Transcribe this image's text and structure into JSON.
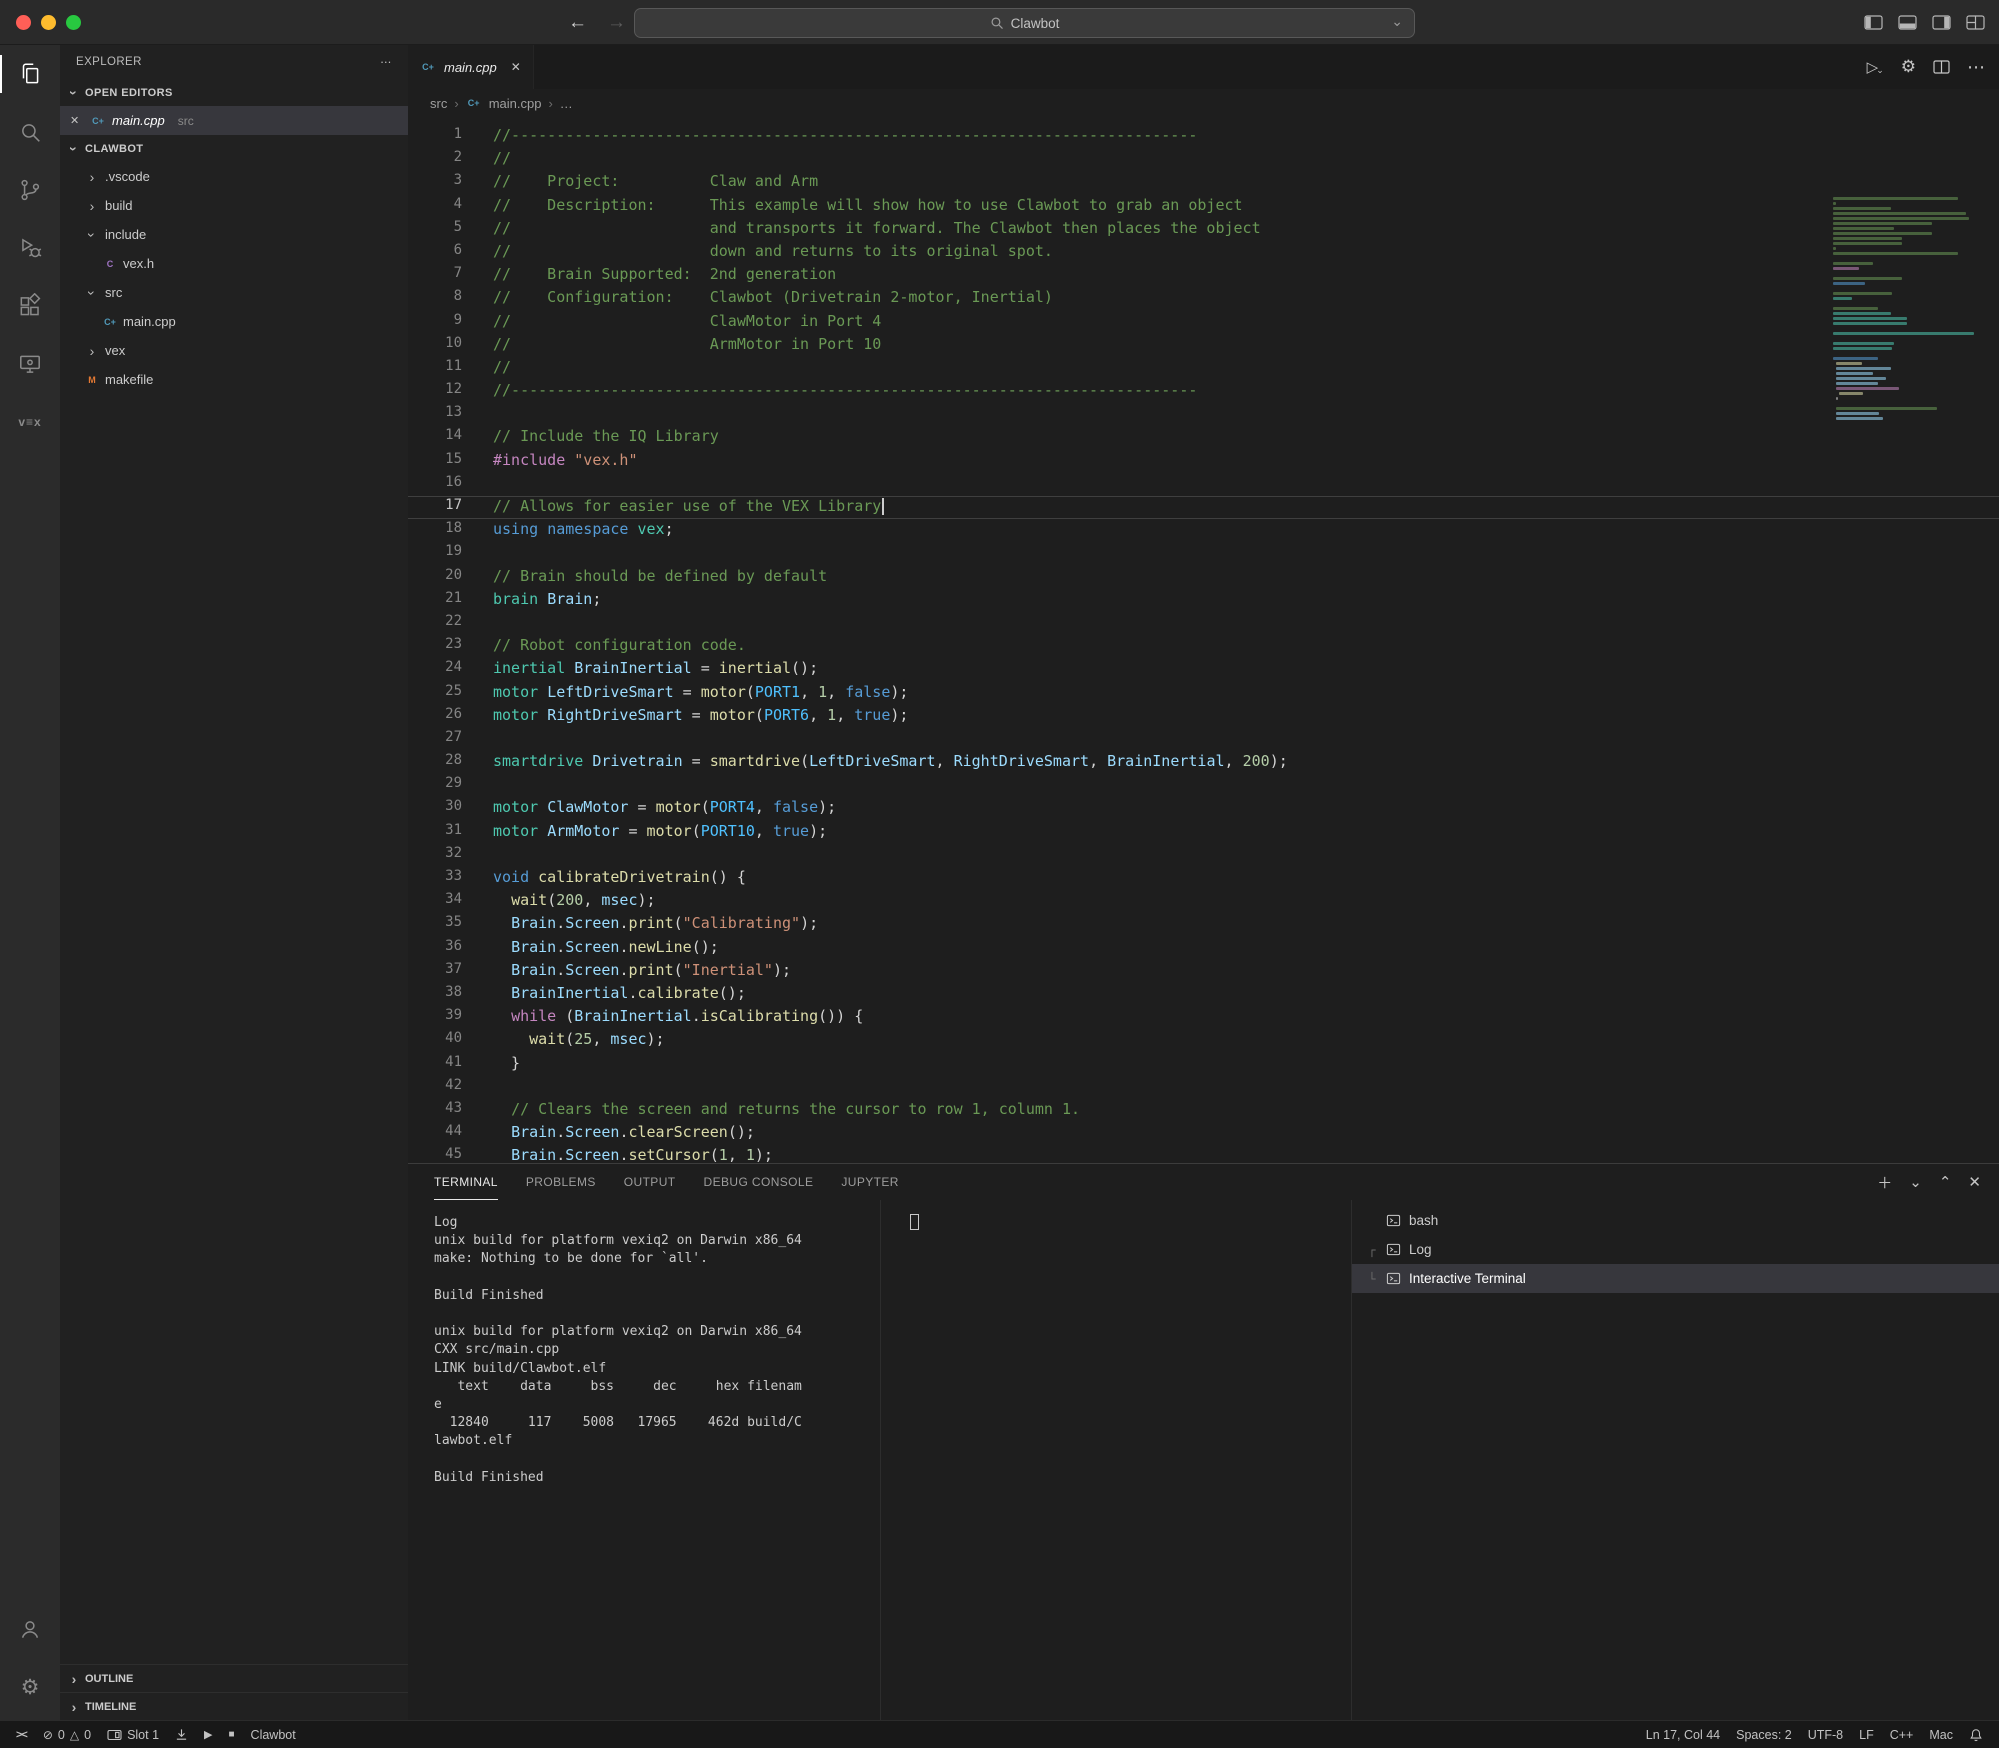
{
  "colors": {
    "traffic_red": "#FF5F57",
    "traffic_yellow": "#FEBC2E",
    "traffic_green": "#28C840",
    "selection_bg": "#37373D",
    "token_comment": "#6A9955",
    "token_keyword": "#569CD6",
    "token_control": "#C586C0",
    "token_type": "#4EC9B0",
    "token_variable": "#9CDCFE",
    "token_function": "#DCDCAA",
    "token_number": "#B5CEA8",
    "token_string": "#CE9178",
    "token_constant": "#4FC1FF"
  },
  "window": {
    "search_value": "Clawbot"
  },
  "activity_bar": {
    "top": [
      "explorer",
      "search",
      "source-control",
      "run-debug",
      "extensions",
      "remote-explorer",
      "vex"
    ],
    "vex_logo": "v≡x",
    "bottom": [
      "account",
      "settings"
    ]
  },
  "sidebar": {
    "title": "EXPLORER",
    "open_editors_label": "OPEN EDITORS",
    "root": "CLAWBOT",
    "open_editors": [
      {
        "label": "main.cpp",
        "detail": "src",
        "icon": "cpp"
      }
    ],
    "tree": [
      {
        "label": ".vscode",
        "kind": "folder",
        "state": "collapsed",
        "depth": 0
      },
      {
        "label": "build",
        "kind": "folder",
        "state": "collapsed",
        "depth": 0
      },
      {
        "label": "include",
        "kind": "folder",
        "state": "expanded",
        "depth": 0
      },
      {
        "label": "vex.h",
        "kind": "file",
        "icon": "h",
        "depth": 1
      },
      {
        "label": "src",
        "kind": "folder",
        "state": "expanded",
        "depth": 0
      },
      {
        "label": "main.cpp",
        "kind": "file",
        "icon": "cpp",
        "depth": 1
      },
      {
        "label": "vex",
        "kind": "folder",
        "state": "collapsed",
        "depth": 0
      },
      {
        "label": "makefile",
        "kind": "file",
        "icon": "makefile",
        "depth": 0
      }
    ],
    "outline_label": "OUTLINE",
    "timeline_label": "TIMELINE"
  },
  "editor": {
    "tab": {
      "label": "main.cpp",
      "icon": "cpp"
    },
    "breadcrumbs": [
      "src",
      "main.cpp",
      "…"
    ],
    "current_line": 17,
    "code": [
      [
        [
          "c",
          "//----------------------------------------------------------------------------"
        ]
      ],
      [
        [
          "c",
          "//"
        ]
      ],
      [
        [
          "c",
          "//    Project:          Claw and Arm"
        ]
      ],
      [
        [
          "c",
          "//    Description:      This example will show how to use Clawbot to grab an object"
        ]
      ],
      [
        [
          "c",
          "//                      and transports it forward. The Clawbot then places the object"
        ]
      ],
      [
        [
          "c",
          "//                      down and returns to its original spot."
        ]
      ],
      [
        [
          "c",
          "//    Brain Supported:  2nd generation"
        ]
      ],
      [
        [
          "c",
          "//    Configuration:    Clawbot (Drivetrain 2-motor, Inertial)"
        ]
      ],
      [
        [
          "c",
          "//                      ClawMotor in Port 4"
        ]
      ],
      [
        [
          "c",
          "//                      ArmMotor in Port 10"
        ]
      ],
      [
        [
          "c",
          "//"
        ]
      ],
      [
        [
          "c",
          "//----------------------------------------------------------------------------"
        ]
      ],
      [],
      [
        [
          "c",
          "// Include the IQ Library"
        ]
      ],
      [
        [
          "ct",
          "#include"
        ],
        [
          "p",
          " "
        ],
        [
          "s",
          "\"vex.h\""
        ]
      ],
      [],
      [
        [
          "c",
          "// Allows for easier use of the VEX Library"
        ]
      ],
      [
        [
          "k",
          "using"
        ],
        [
          "p",
          " "
        ],
        [
          "k",
          "namespace"
        ],
        [
          "p",
          " "
        ],
        [
          "t",
          "vex"
        ],
        [
          "p",
          ";"
        ]
      ],
      [],
      [
        [
          "c",
          "// Brain should be defined by default"
        ]
      ],
      [
        [
          "t",
          "brain"
        ],
        [
          "p",
          " "
        ],
        [
          "v",
          "Brain"
        ],
        [
          "p",
          ";"
        ]
      ],
      [],
      [
        [
          "c",
          "// Robot configuration code."
        ]
      ],
      [
        [
          "t",
          "inertial"
        ],
        [
          "p",
          " "
        ],
        [
          "v",
          "BrainInertial"
        ],
        [
          "p",
          " = "
        ],
        [
          "f",
          "inertial"
        ],
        [
          "p",
          "();"
        ]
      ],
      [
        [
          "t",
          "motor"
        ],
        [
          "p",
          " "
        ],
        [
          "v",
          "LeftDriveSmart"
        ],
        [
          "p",
          " = "
        ],
        [
          "f",
          "motor"
        ],
        [
          "p",
          "("
        ],
        [
          "cn",
          "PORT1"
        ],
        [
          "p",
          ", "
        ],
        [
          "n",
          "1"
        ],
        [
          "p",
          ", "
        ],
        [
          "k",
          "false"
        ],
        [
          "p",
          ");"
        ]
      ],
      [
        [
          "t",
          "motor"
        ],
        [
          "p",
          " "
        ],
        [
          "v",
          "RightDriveSmart"
        ],
        [
          "p",
          " = "
        ],
        [
          "f",
          "motor"
        ],
        [
          "p",
          "("
        ],
        [
          "cn",
          "PORT6"
        ],
        [
          "p",
          ", "
        ],
        [
          "n",
          "1"
        ],
        [
          "p",
          ", "
        ],
        [
          "k",
          "true"
        ],
        [
          "p",
          ");"
        ]
      ],
      [],
      [
        [
          "t",
          "smartdrive"
        ],
        [
          "p",
          " "
        ],
        [
          "v",
          "Drivetrain"
        ],
        [
          "p",
          " = "
        ],
        [
          "f",
          "smartdrive"
        ],
        [
          "p",
          "("
        ],
        [
          "v",
          "LeftDriveSmart"
        ],
        [
          "p",
          ", "
        ],
        [
          "v",
          "RightDriveSmart"
        ],
        [
          "p",
          ", "
        ],
        [
          "v",
          "BrainInertial"
        ],
        [
          "p",
          ", "
        ],
        [
          "n",
          "200"
        ],
        [
          "p",
          ");"
        ]
      ],
      [],
      [
        [
          "t",
          "motor"
        ],
        [
          "p",
          " "
        ],
        [
          "v",
          "ClawMotor"
        ],
        [
          "p",
          " = "
        ],
        [
          "f",
          "motor"
        ],
        [
          "p",
          "("
        ],
        [
          "cn",
          "PORT4"
        ],
        [
          "p",
          ", "
        ],
        [
          "k",
          "false"
        ],
        [
          "p",
          ");"
        ]
      ],
      [
        [
          "t",
          "motor"
        ],
        [
          "p",
          " "
        ],
        [
          "v",
          "ArmMotor"
        ],
        [
          "p",
          " = "
        ],
        [
          "f",
          "motor"
        ],
        [
          "p",
          "("
        ],
        [
          "cn",
          "PORT10"
        ],
        [
          "p",
          ", "
        ],
        [
          "k",
          "true"
        ],
        [
          "p",
          ");"
        ]
      ],
      [],
      [
        [
          "k",
          "void"
        ],
        [
          "p",
          " "
        ],
        [
          "f",
          "calibrateDrivetrain"
        ],
        [
          "p",
          "() {"
        ]
      ],
      [
        [
          "p",
          "  "
        ],
        [
          "f",
          "wait"
        ],
        [
          "p",
          "("
        ],
        [
          "n",
          "200"
        ],
        [
          "p",
          ", "
        ],
        [
          "v",
          "msec"
        ],
        [
          "p",
          ");"
        ]
      ],
      [
        [
          "p",
          "  "
        ],
        [
          "v",
          "Brain"
        ],
        [
          "p",
          "."
        ],
        [
          "v",
          "Screen"
        ],
        [
          "p",
          "."
        ],
        [
          "f",
          "print"
        ],
        [
          "p",
          "("
        ],
        [
          "s",
          "\"Calibrating\""
        ],
        [
          "p",
          ");"
        ]
      ],
      [
        [
          "p",
          "  "
        ],
        [
          "v",
          "Brain"
        ],
        [
          "p",
          "."
        ],
        [
          "v",
          "Screen"
        ],
        [
          "p",
          "."
        ],
        [
          "f",
          "newLine"
        ],
        [
          "p",
          "();"
        ]
      ],
      [
        [
          "p",
          "  "
        ],
        [
          "v",
          "Brain"
        ],
        [
          "p",
          "."
        ],
        [
          "v",
          "Screen"
        ],
        [
          "p",
          "."
        ],
        [
          "f",
          "print"
        ],
        [
          "p",
          "("
        ],
        [
          "s",
          "\"Inertial\""
        ],
        [
          "p",
          ");"
        ]
      ],
      [
        [
          "p",
          "  "
        ],
        [
          "v",
          "BrainInertial"
        ],
        [
          "p",
          "."
        ],
        [
          "f",
          "calibrate"
        ],
        [
          "p",
          "();"
        ]
      ],
      [
        [
          "p",
          "  "
        ],
        [
          "ct",
          "while"
        ],
        [
          "p",
          " ("
        ],
        [
          "v",
          "BrainInertial"
        ],
        [
          "p",
          "."
        ],
        [
          "f",
          "isCalibrating"
        ],
        [
          "p",
          "()) {"
        ]
      ],
      [
        [
          "p",
          "    "
        ],
        [
          "f",
          "wait"
        ],
        [
          "p",
          "("
        ],
        [
          "n",
          "25"
        ],
        [
          "p",
          ", "
        ],
        [
          "v",
          "msec"
        ],
        [
          "p",
          ");"
        ]
      ],
      [
        [
          "p",
          "  }"
        ]
      ],
      [],
      [
        [
          "p",
          "  "
        ],
        [
          "c",
          "// Clears the screen and returns the cursor to row 1, column 1."
        ]
      ],
      [
        [
          "p",
          "  "
        ],
        [
          "v",
          "Brain"
        ],
        [
          "p",
          "."
        ],
        [
          "v",
          "Screen"
        ],
        [
          "p",
          "."
        ],
        [
          "f",
          "clearScreen"
        ],
        [
          "p",
          "();"
        ]
      ],
      [
        [
          "p",
          "  "
        ],
        [
          "v",
          "Brain"
        ],
        [
          "p",
          "."
        ],
        [
          "v",
          "Screen"
        ],
        [
          "p",
          "."
        ],
        [
          "f",
          "setCursor"
        ],
        [
          "p",
          "("
        ],
        [
          "n",
          "1"
        ],
        [
          "p",
          ", "
        ],
        [
          "n",
          "1"
        ],
        [
          "p",
          ");"
        ]
      ]
    ]
  },
  "panel": {
    "tabs": [
      {
        "label": "TERMINAL",
        "active": true
      },
      {
        "label": "PROBLEMS",
        "active": false
      },
      {
        "label": "OUTPUT",
        "active": false
      },
      {
        "label": "DEBUG CONSOLE",
        "active": false
      },
      {
        "label": "JUPYTER",
        "active": false
      }
    ],
    "terminal_output": [
      "Log",
      "unix build for platform vexiq2 on Darwin x86_64",
      "make: Nothing to be done for `all'.",
      "",
      "Build Finished",
      "",
      "unix build for platform vexiq2 on Darwin x86_64",
      "CXX src/main.cpp",
      "LINK build/Clawbot.elf",
      "   text    data     bss     dec     hex filenam",
      "e",
      "  12840     117    5008   17965    462d build/C",
      "lawbot.elf",
      "",
      "Build Finished"
    ],
    "terminal_list": [
      {
        "label": "bash",
        "guide": "",
        "selected": false
      },
      {
        "label": "Log",
        "guide": "┌",
        "selected": false
      },
      {
        "label": "Interactive Terminal",
        "guide": "└",
        "selected": true
      }
    ]
  },
  "status_bar": {
    "errors": "0",
    "warnings": "0",
    "slot": "Slot 1",
    "project": "Clawbot",
    "ln_col": "Ln 17, Col 44",
    "spaces": "Spaces: 2",
    "encoding": "UTF-8",
    "eol": "LF",
    "language": "C++",
    "platform": "Mac"
  }
}
